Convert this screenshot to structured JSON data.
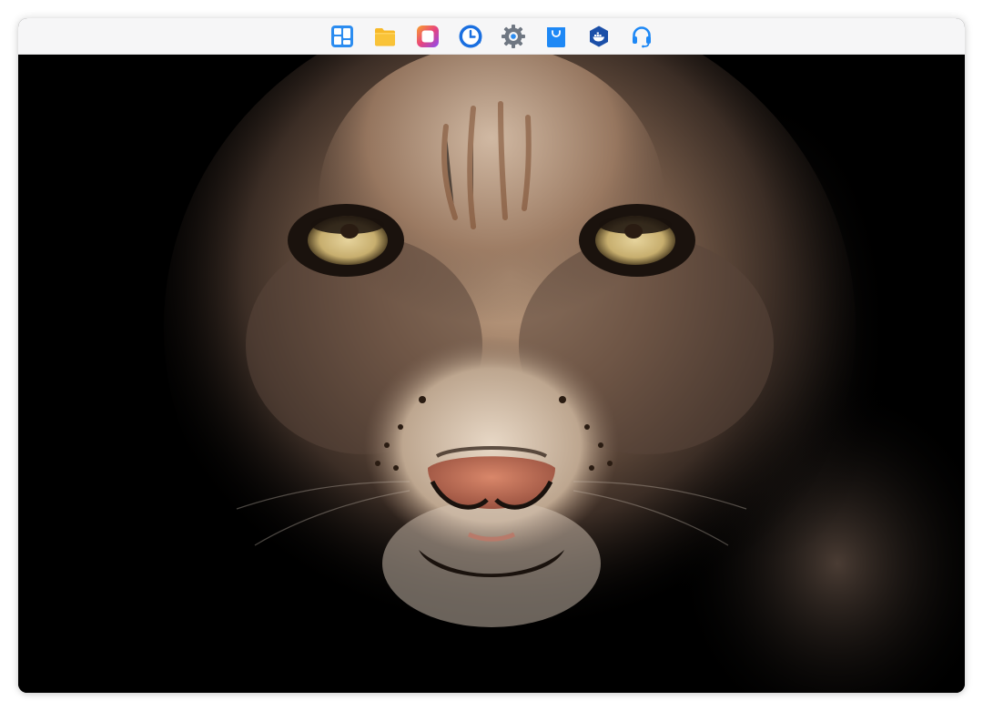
{
  "taskbar": {
    "apps": [
      {
        "id": "main-menu",
        "icon": "grid-menu-icon",
        "color": "#2b8cf0"
      },
      {
        "id": "file-manager",
        "icon": "folder-icon",
        "color": "#f7b928"
      },
      {
        "id": "photos",
        "icon": "photos-icon",
        "color": "#e8457c"
      },
      {
        "id": "backup",
        "icon": "clock-backup-icon",
        "color": "#1a6fe0"
      },
      {
        "id": "settings",
        "icon": "gear-icon",
        "color": "#6f7782"
      },
      {
        "id": "app-store",
        "icon": "shopping-bag-icon",
        "color": "#1e88f5"
      },
      {
        "id": "docker",
        "icon": "docker-icon",
        "color": "#1b4fa8"
      },
      {
        "id": "support",
        "icon": "headset-icon",
        "color": "#1e88f5"
      }
    ]
  },
  "wallpaper": {
    "subject": "lynx-face-icon",
    "background_color": "#000000"
  }
}
